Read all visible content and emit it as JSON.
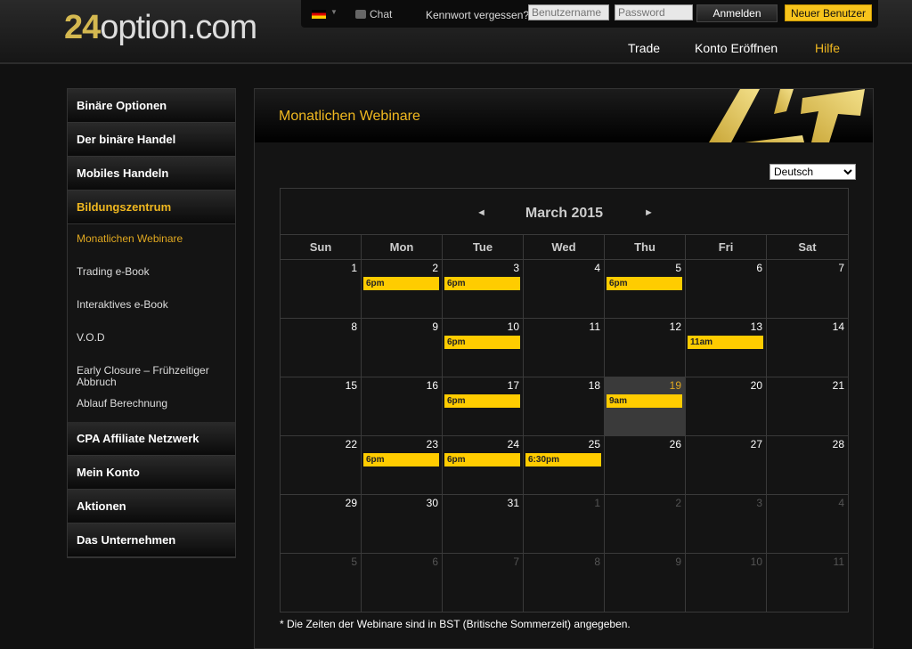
{
  "logo": {
    "num": "24",
    "rest": "option.com"
  },
  "topbar": {
    "language_flag": "de-flag-icon",
    "chat": "Chat",
    "forgot": "Kennwort vergessen?",
    "username_placeholder": "Benutzername",
    "password_placeholder": "Password",
    "login": "Anmelden",
    "register": "Neuer Benutzer"
  },
  "nav": [
    "Trade",
    "Konto Eröffnen",
    "Hilfe"
  ],
  "sidebar": {
    "items": [
      {
        "label": "Binäre Optionen",
        "type": "main"
      },
      {
        "label": "Der binäre Handel",
        "type": "main"
      },
      {
        "label": "Mobiles Handeln",
        "type": "main"
      },
      {
        "label": "Bildungszentrum",
        "type": "main",
        "active": true
      },
      {
        "label": "Monatlichen Webinare",
        "type": "sub",
        "active": true
      },
      {
        "label": "Trading e-Book",
        "type": "sub"
      },
      {
        "label": "Interaktives e-Book",
        "type": "sub"
      },
      {
        "label": "V.O.D",
        "type": "sub"
      },
      {
        "label": "Early Closure – Frühzeitiger Abbruch",
        "type": "sub"
      },
      {
        "label": "Ablauf Berechnung",
        "type": "sub"
      },
      {
        "label": "CPA Affiliate Netzwerk",
        "type": "main"
      },
      {
        "label": "Mein Konto",
        "type": "main"
      },
      {
        "label": "Aktionen",
        "type": "main"
      },
      {
        "label": "Das Unternehmen",
        "type": "main"
      }
    ]
  },
  "main": {
    "title": "Monatlichen Webinare",
    "language": "Deutsch",
    "calendar": {
      "month": "March 2015",
      "prev": "◄",
      "next": "►",
      "days": [
        "Sun",
        "Mon",
        "Tue",
        "Wed",
        "Thu",
        "Fri",
        "Sat"
      ],
      "today": 19,
      "cells": [
        1,
        2,
        3,
        4,
        5,
        6,
        7,
        8,
        9,
        10,
        11,
        12,
        13,
        14,
        15,
        16,
        17,
        18,
        19,
        20,
        21,
        22,
        23,
        24,
        25,
        26,
        27,
        28,
        29,
        30,
        31,
        1,
        2,
        3,
        4,
        5,
        6,
        7,
        8,
        9,
        10,
        11
      ],
      "events": {
        "2": "6pm",
        "3": "6pm",
        "5": "6pm",
        "10": "6pm",
        "13": "11am",
        "17": "6pm",
        "19": "9am",
        "23": "6pm",
        "24": "6pm",
        "25": "6:30pm"
      }
    },
    "note": "* Die Zeiten der Webinare sind in BST (Britische Sommerzeit) angegeben."
  },
  "colors": {
    "accent": "#f0b820",
    "event": "#ffcc00"
  }
}
